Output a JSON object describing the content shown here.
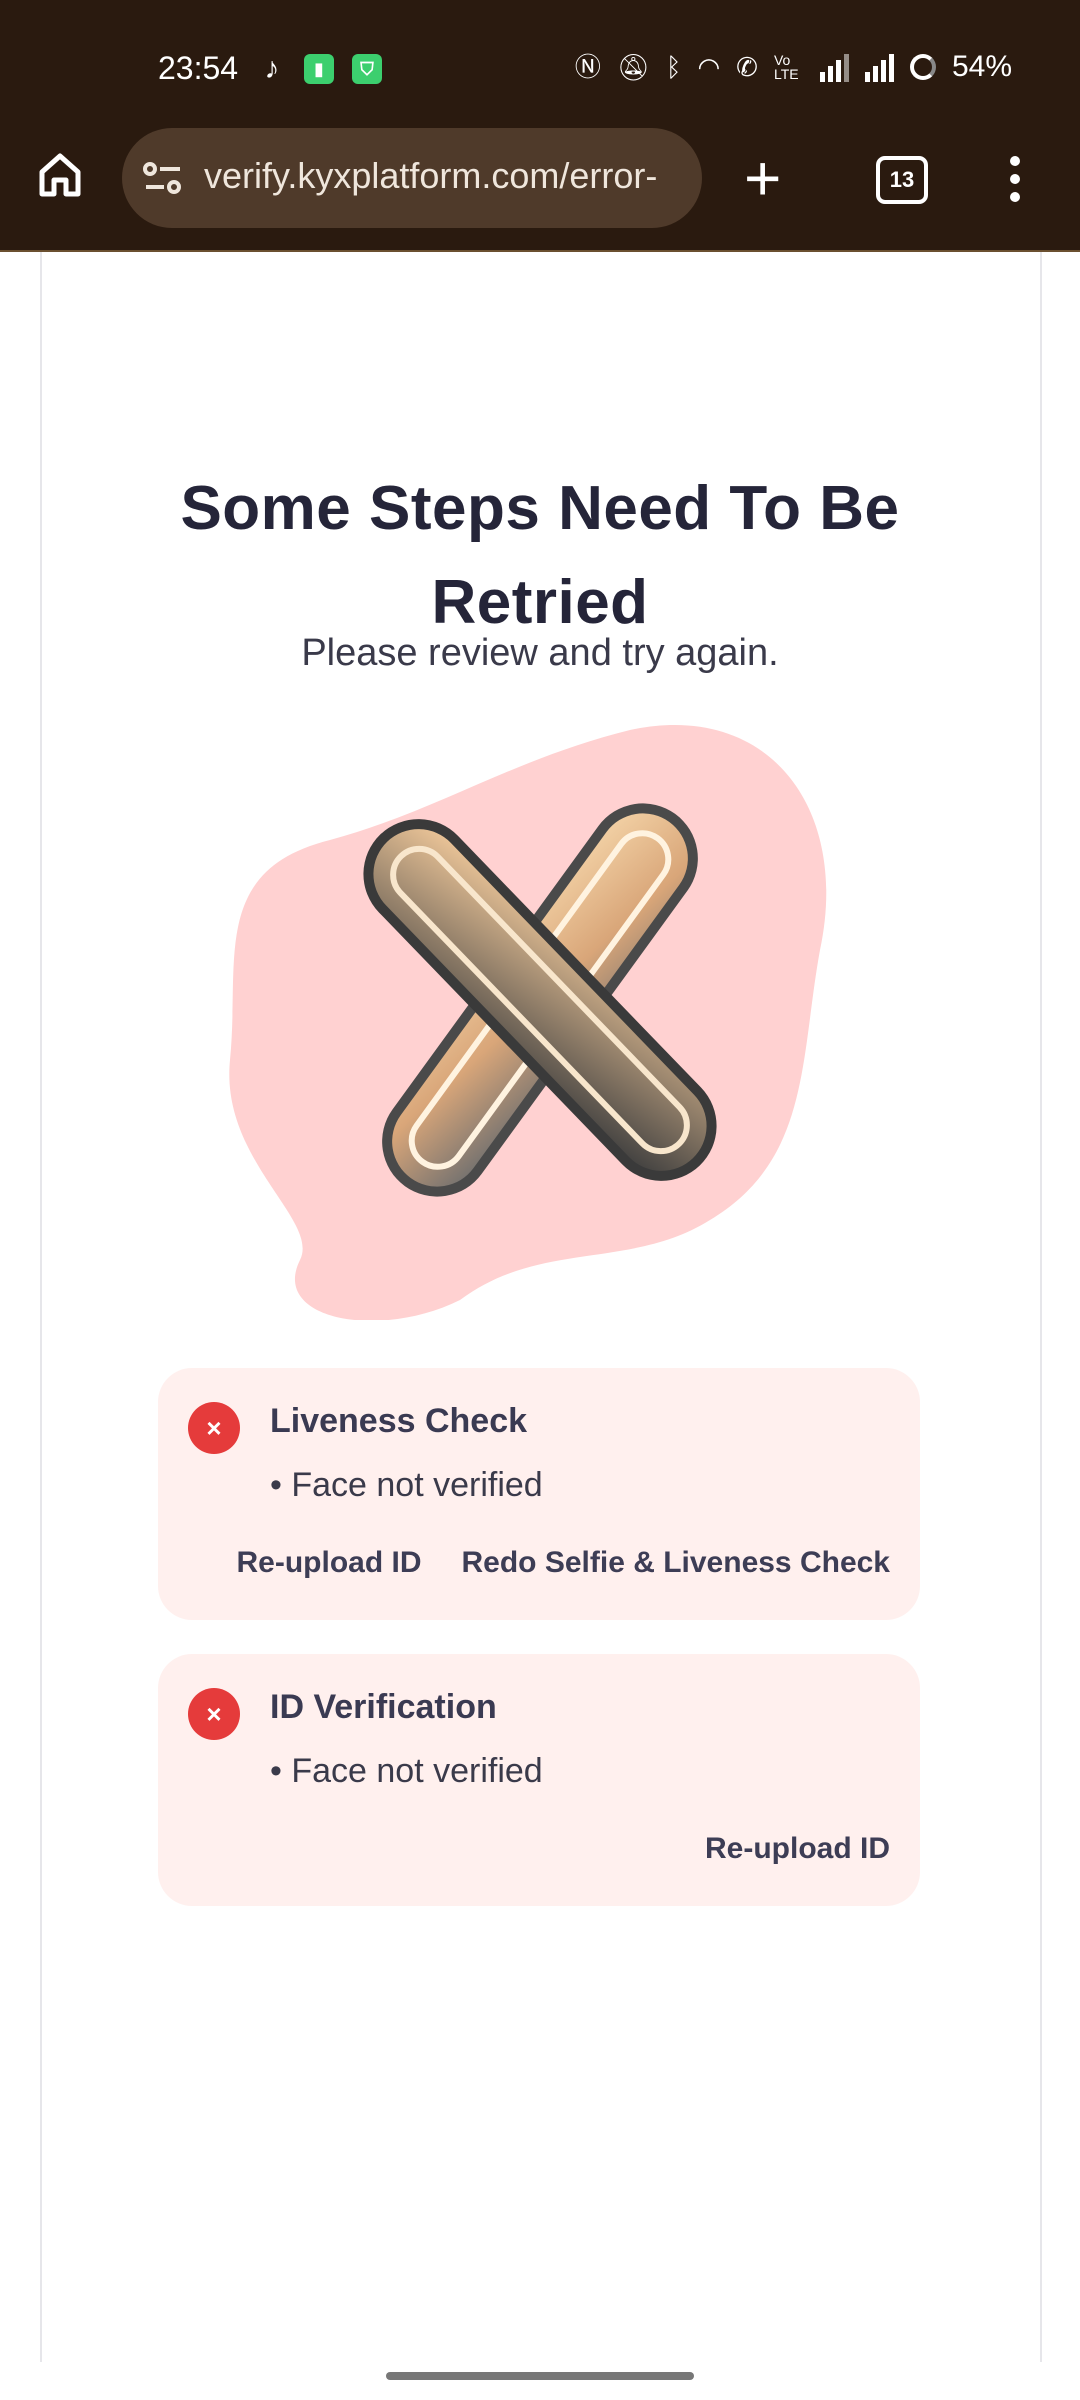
{
  "status_bar": {
    "time": "23:54",
    "battery_percent": "54%",
    "icons": [
      "tiktok-icon",
      "battery-app-icon",
      "shield-app-icon",
      "nfc-icon",
      "mute-icon",
      "bluetooth-icon",
      "wifi-icon",
      "wifi-calling-icon",
      "volte-icon",
      "signal-icon",
      "signal-icon",
      "battery-icon"
    ],
    "volte_label": "Vo LTE"
  },
  "browser": {
    "url": "verify.kyxplatform.com/error-",
    "tab_count": "13"
  },
  "page": {
    "title": "Some Steps Need To Be Retried",
    "subtitle": "Please review and try again.",
    "colors": {
      "accent_error": "#e53b3b",
      "card_bg": "#fff0ee",
      "title": "#252539",
      "blob": "#ffcfcf"
    },
    "checks": [
      {
        "title": "Liveness Check",
        "detail": "• Face not verified",
        "actions": [
          "Re-upload ID",
          "Redo Selfie & Liveness Check"
        ]
      },
      {
        "title": "ID Verification",
        "detail": "• Face not verified",
        "actions": [
          "Re-upload ID"
        ]
      }
    ],
    "badge_symbol": "×"
  }
}
